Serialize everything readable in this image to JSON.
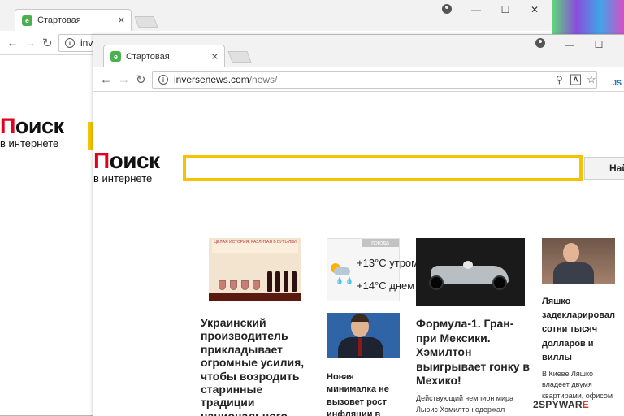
{
  "back_window": {
    "tab_title": "Стартовая",
    "favicon_letter": "e",
    "url_partial": "inve",
    "logo_first": "П",
    "logo_rest": "оиск",
    "logo_sub": "в интернете"
  },
  "front_window": {
    "tab_title": "Стартовая",
    "favicon_letter": "e",
    "url_host": "inversenews.com",
    "url_path": "/news/",
    "logo_first": "П",
    "logo_rest": "оиск",
    "logo_sub": "в интернете",
    "search_placeholder": "",
    "search_button": "Найти"
  },
  "weather": {
    "tag": "погода",
    "morning": "+13°C утром",
    "day": "+14°C днем"
  },
  "wine_banner": "ЦЕЛАЯ ИСТОРИЯ, РАЗЛИТАЯ В БУТЫЛКИ",
  "news": [
    {
      "title": "Украинский производитель прикладывает огромные усилия, чтобы возродить старинные традиции национального"
    },
    {
      "title": "Новая минималка не вызовет рост инфляции в"
    },
    {
      "title": "Формула-1. Гран-при Мексики. Хэмилтон выигрывает гонку в Мехико!",
      "snippet": "Действующий чемпион мира Льюис Хэмилтон одержал"
    },
    {
      "title": "Ляшко задекларировал сотни тысяч долларов и виллы",
      "snippet": "В Киеве Ляшко владеет двумя квартирами, офисом"
    }
  ],
  "watermark": {
    "prefix": "2SPYWAR",
    "suffix": "E"
  },
  "icons": {
    "back": "arrow-left-icon",
    "forward": "arrow-right-icon",
    "reload": "reload-icon",
    "info": "info-icon",
    "zoom": "magnifier-icon",
    "translate": "translate-icon",
    "bookmark": "star-icon",
    "profile": "profile-icon"
  },
  "colors": {
    "accent_yellow": "#f5c400",
    "logo_red": "#e3001b",
    "favicon_green": "#4caf50"
  }
}
